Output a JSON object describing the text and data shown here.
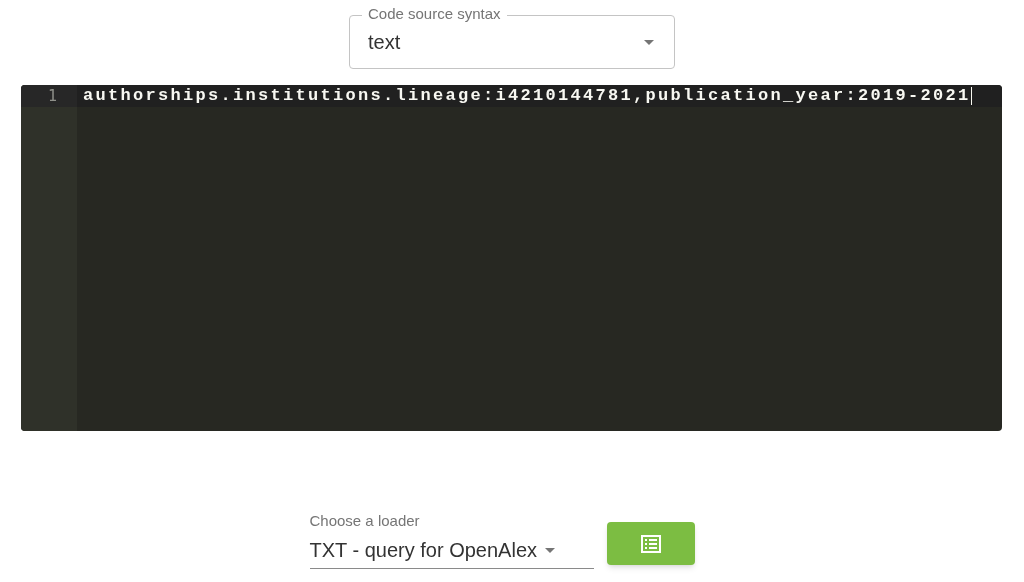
{
  "syntax_select": {
    "label": "Code source syntax",
    "value": "text"
  },
  "editor": {
    "lines": [
      {
        "number": "1",
        "text": "authorships.institutions.lineage:i4210144781,publication_year:2019-2021",
        "active": true
      }
    ]
  },
  "loader_select": {
    "label": "Choose a loader",
    "value": "TXT - query for OpenAlex"
  }
}
